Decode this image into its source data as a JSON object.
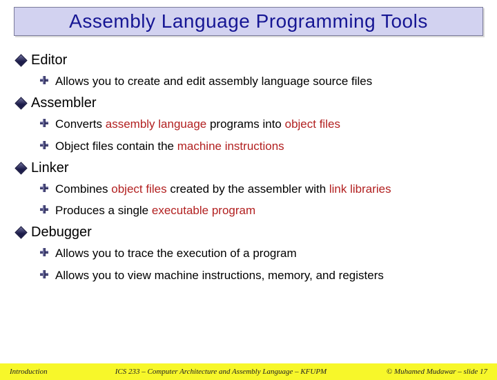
{
  "title": "Assembly Language Programming Tools",
  "sections": {
    "s0": {
      "head": "Editor",
      "i0": {
        "pre": "Allows you to create and edit assembly language source files"
      }
    },
    "s1": {
      "head": "Assembler",
      "i0": {
        "pre": "Converts ",
        "h0": "assembly language",
        "mid0": " programs into ",
        "h1": "object files"
      },
      "i1": {
        "pre": "Object files contain the ",
        "h0": "machine instructions"
      }
    },
    "s2": {
      "head": "Linker",
      "i0": {
        "pre": "Combines ",
        "h0": "object files",
        "mid0": " created by the assembler with ",
        "h1": "link libraries"
      },
      "i1": {
        "pre": "Produces a single ",
        "h0": "executable program"
      }
    },
    "s3": {
      "head": "Debugger",
      "i0": {
        "pre": "Allows you to trace the execution of a program"
      },
      "i1": {
        "pre": "Allows you to view machine instructions, memory, and registers"
      }
    }
  },
  "footer": {
    "left": "Introduction",
    "center": "ICS 233 – Computer Architecture and Assembly Language – KFUPM",
    "right": "© Muhamed Mudawar – slide 17"
  }
}
